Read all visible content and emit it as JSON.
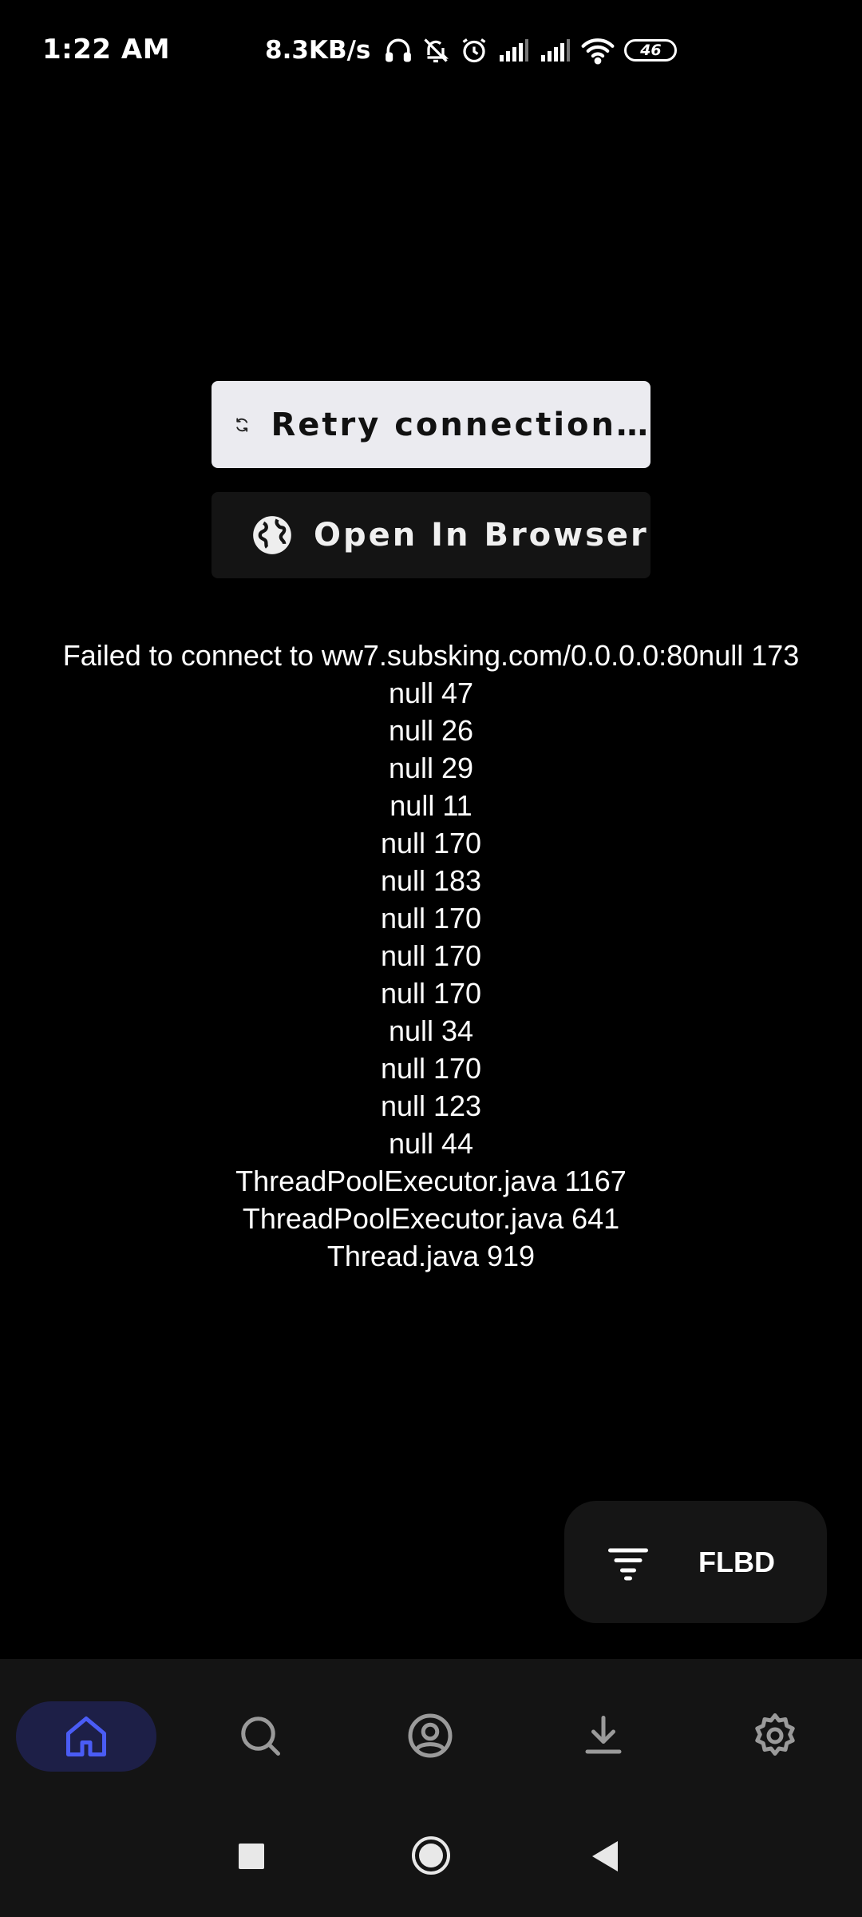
{
  "status_bar": {
    "time": "1:22 AM",
    "net_speed": "8.3KB/s",
    "battery": "46",
    "icons": [
      "headphones-icon",
      "bell-muted-icon",
      "alarm-icon",
      "signal-icon",
      "signal-icon",
      "wifi-icon",
      "battery-icon"
    ]
  },
  "actions": {
    "retry_label": "Retry connection…",
    "browser_label": "Open In Browser"
  },
  "error": {
    "lines": [
      "Failed to connect to ww7.subsking.com/0.0.0.0:80null 173",
      "null 47",
      "null 26",
      "null 29",
      "null 11",
      "null 170",
      "null 183",
      "null 170",
      "null 170",
      "null 170",
      "null 34",
      "null 170",
      "null 123",
      "null 44",
      "ThreadPoolExecutor.java 1167",
      "ThreadPoolExecutor.java 641",
      "Thread.java 919"
    ]
  },
  "fab": {
    "label": "FLBD",
    "icon": "filter-icon"
  },
  "bottom_nav": {
    "items": [
      "home-icon",
      "search-icon",
      "account-icon",
      "download-icon",
      "settings-icon"
    ],
    "active": "home",
    "accent_color": "#4a5cf5"
  },
  "system_nav": {
    "buttons": [
      "recents-button",
      "home-button",
      "back-button"
    ]
  }
}
